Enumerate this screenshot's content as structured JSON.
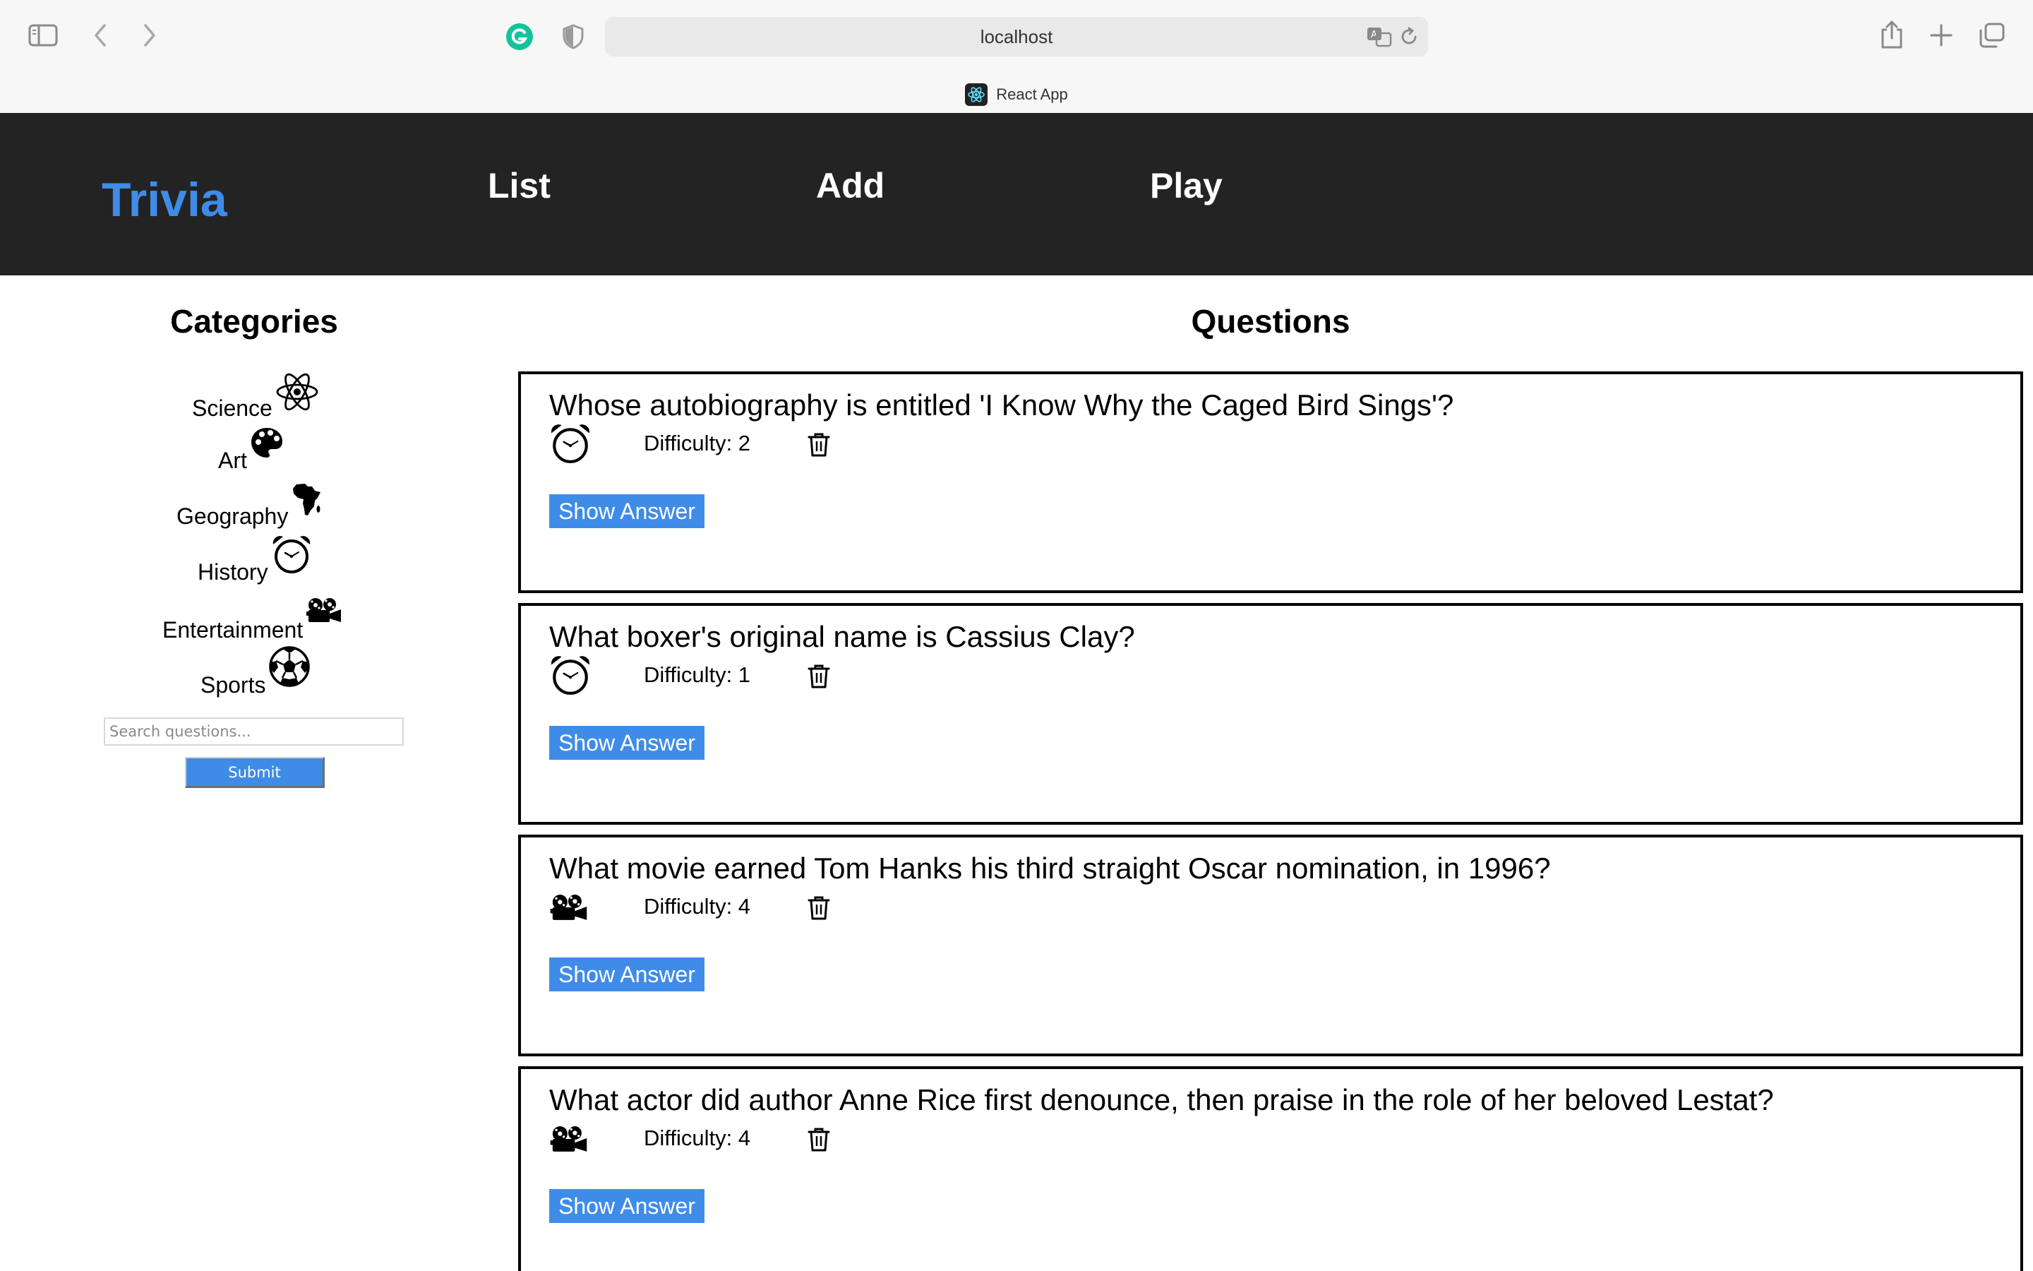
{
  "browser": {
    "address": "localhost",
    "tab_title": "React App"
  },
  "app": {
    "brand": "Trivia",
    "nav": [
      "List",
      "Add",
      "Play"
    ],
    "accent_color": "#3f8ce8",
    "header_bg": "#232323"
  },
  "categories": {
    "title": "Categories",
    "items": [
      {
        "label": "Science",
        "icon": "atom-icon"
      },
      {
        "label": "Art",
        "icon": "palette-icon"
      },
      {
        "label": "Geography",
        "icon": "africa-map-icon"
      },
      {
        "label": "History",
        "icon": "alarm-clock-icon"
      },
      {
        "label": "Entertainment",
        "icon": "film-projector-icon"
      },
      {
        "label": "Sports",
        "icon": "soccer-ball-icon"
      }
    ]
  },
  "search": {
    "placeholder": "Search questions...",
    "value": "",
    "submit_label": "Submit"
  },
  "questions": {
    "title": "Questions",
    "items": [
      {
        "text": "Whose autobiography is entitled 'I Know Why the Caged Bird Sings'?",
        "difficulty": "Difficulty: 2",
        "category_icon": "alarm-clock-icon",
        "show_label": "Show Answer"
      },
      {
        "text": "What boxer's original name is Cassius Clay?",
        "difficulty": "Difficulty: 1",
        "category_icon": "alarm-clock-icon",
        "show_label": "Show Answer"
      },
      {
        "text": "What movie earned Tom Hanks his third straight Oscar nomination, in 1996?",
        "difficulty": "Difficulty: 4",
        "category_icon": "film-projector-icon",
        "show_label": "Show Answer"
      },
      {
        "text": "What actor did author Anne Rice first denounce, then praise in the role of her beloved Lestat?",
        "difficulty": "Difficulty: 4",
        "category_icon": "film-projector-icon",
        "show_label": "Show Answer"
      }
    ]
  }
}
